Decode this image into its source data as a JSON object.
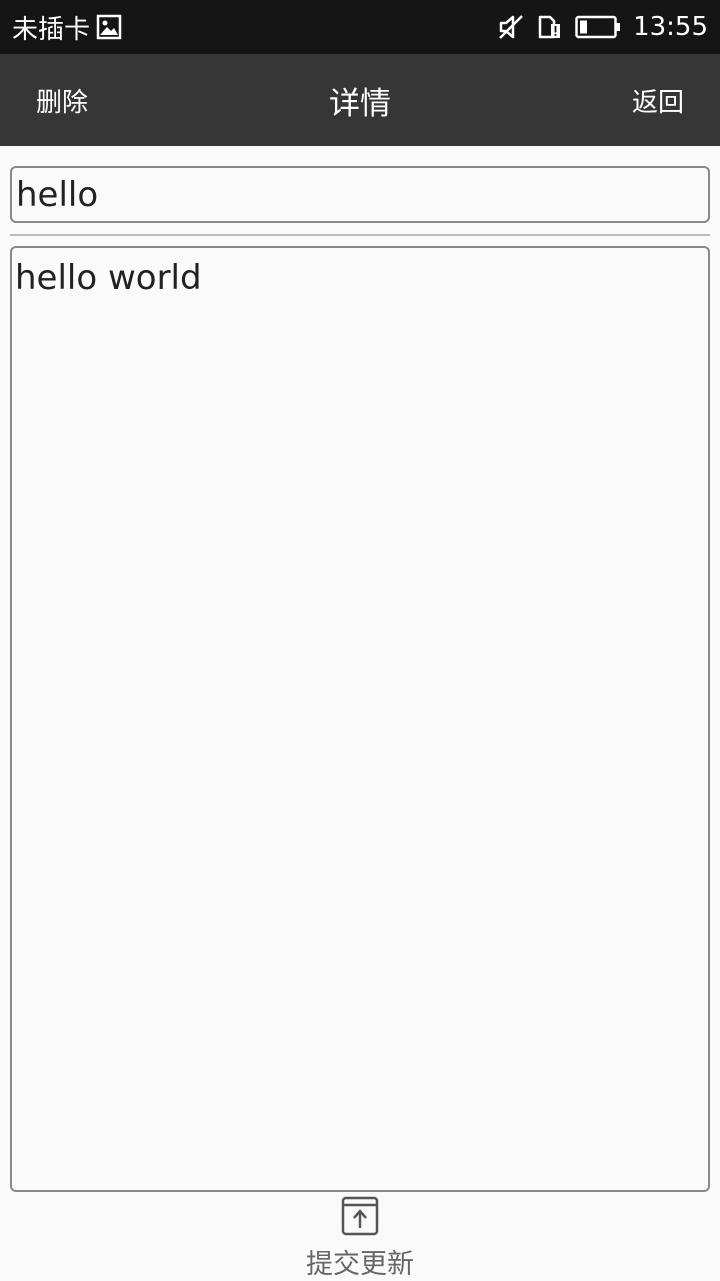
{
  "status_bar": {
    "carrier": "未插卡",
    "time": "13:55",
    "icons": [
      "image-icon",
      "mute-icon",
      "sim-alert-icon",
      "battery-icon"
    ]
  },
  "toolbar": {
    "delete_label": "删除",
    "title": "详情",
    "back_label": "返回"
  },
  "form": {
    "title_value": "hello",
    "content_value": "hello world"
  },
  "footer": {
    "submit_label": "提交更新",
    "submit_icon": "upload-icon"
  }
}
